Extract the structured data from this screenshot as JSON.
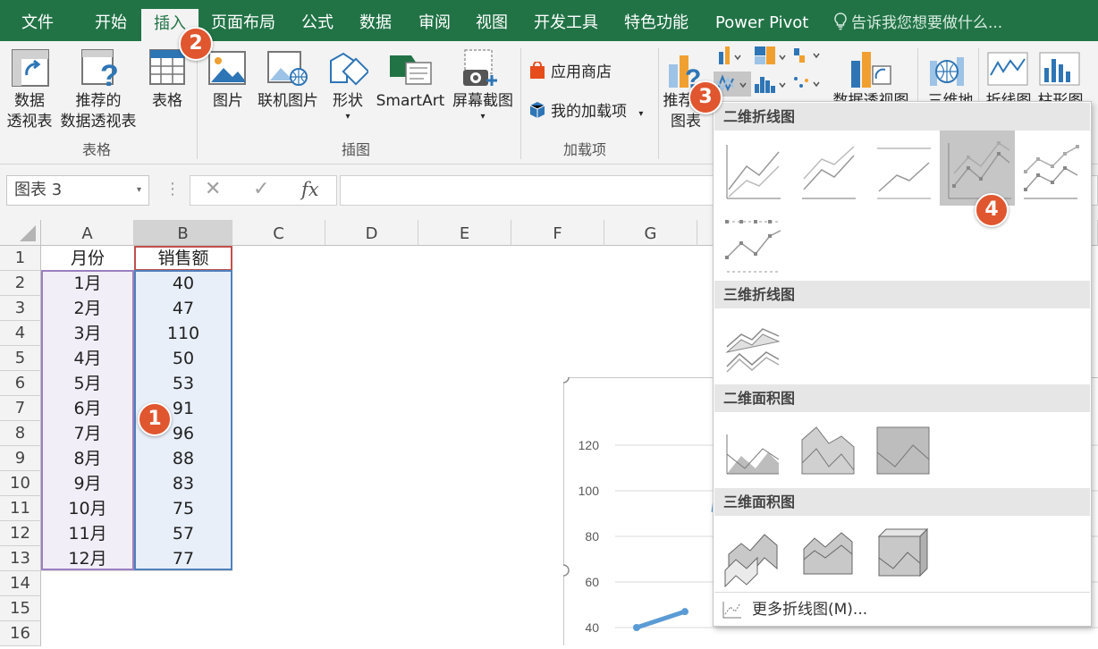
{
  "tabs": [
    "文件",
    "开始",
    "插入",
    "页面布局",
    "公式",
    "数据",
    "审阅",
    "视图",
    "开发工具",
    "特色功能",
    "Power Pivot"
  ],
  "active_tab": "插入",
  "tell_me": "告诉我您想要做什么...",
  "ribbon": {
    "pivot_table": [
      "数据",
      "透视表"
    ],
    "recommended_pivot": [
      "推荐的",
      "数据透视表"
    ],
    "table": "表格",
    "group_tables": "表格",
    "picture": "图片",
    "online_picture": "联机图片",
    "shapes": "形状",
    "smartart": "SmartArt",
    "screenshot": "屏幕截图",
    "group_illustrations": "插图",
    "app_store": "应用商店",
    "my_addins": "我的加载项",
    "group_addins": "加载项",
    "recommended_charts": [
      "推荐的",
      "图表"
    ],
    "pivot_chart": "数据透视图",
    "map3d": "三维地",
    "line_spark": "折线图",
    "column_spark": "柱形图"
  },
  "formula_bar": {
    "name_box": "图表 3",
    "fx": "fx",
    "cancel": "✕",
    "enter": "✓",
    "value": ""
  },
  "columns": [
    "A",
    "B",
    "C",
    "D",
    "E",
    "F",
    "G"
  ],
  "rows": [
    "1",
    "2",
    "3",
    "4",
    "5",
    "6",
    "7",
    "8",
    "9",
    "10",
    "11",
    "12",
    "13",
    "14",
    "15",
    "16"
  ],
  "table": {
    "header": [
      "月份",
      "销售额"
    ],
    "data": [
      [
        "1月",
        "40"
      ],
      [
        "2月",
        "47"
      ],
      [
        "3月",
        "110"
      ],
      [
        "4月",
        "50"
      ],
      [
        "5月",
        "53"
      ],
      [
        "6月",
        "91"
      ],
      [
        "7月",
        "96"
      ],
      [
        "8月",
        "88"
      ],
      [
        "9月",
        "83"
      ],
      [
        "10月",
        "75"
      ],
      [
        "11月",
        "57"
      ],
      [
        "12月",
        "77"
      ]
    ]
  },
  "chart": {
    "y_ticks": [
      "120",
      "100",
      "80",
      "60",
      "40"
    ],
    "visible_values": [
      40,
      47
    ]
  },
  "gallery": {
    "section_2d_line": "二维折线图",
    "section_3d_line": "三维折线图",
    "section_2d_area": "二维面积图",
    "section_3d_area": "三维面积图",
    "more": "更多折线图(M)..."
  },
  "callouts": [
    "1",
    "2",
    "3",
    "4"
  ],
  "colors": {
    "excel_green": "#217346",
    "callout": "#e0562f",
    "chart_line": "#5b9bd5"
  }
}
